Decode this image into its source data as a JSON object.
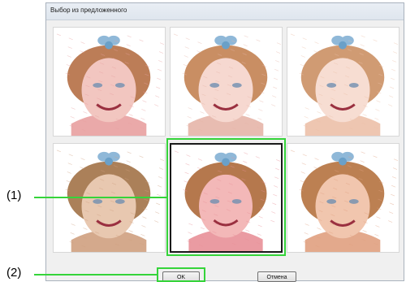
{
  "dialog": {
    "title": "Выбор из предложенного",
    "thumbnails": [
      {
        "tone": "#e8a0a0",
        "hair": "#b0663a",
        "face": "#f2c6c0",
        "selected": false
      },
      {
        "tone": "#e6b5a8",
        "hair": "#c07a48",
        "face": "#f6d8d0",
        "selected": false
      },
      {
        "tone": "#ecc0a8",
        "hair": "#c88a5a",
        "face": "#f7ddd2",
        "selected": false
      },
      {
        "tone": "#cfa080",
        "hair": "#9c6a3c",
        "face": "#e8c8b0",
        "selected": false
      },
      {
        "tone": "#e89098",
        "hair": "#a8602e",
        "face": "#f3b8b8",
        "selected": true
      },
      {
        "tone": "#e0a080",
        "hair": "#b06a34",
        "face": "#f1c6ae",
        "selected": false
      }
    ],
    "ok_label": "OK",
    "cancel_label": "Отмена"
  },
  "callouts": {
    "label_1": "(1)",
    "label_2": "(2)",
    "color": "#35d43a"
  }
}
